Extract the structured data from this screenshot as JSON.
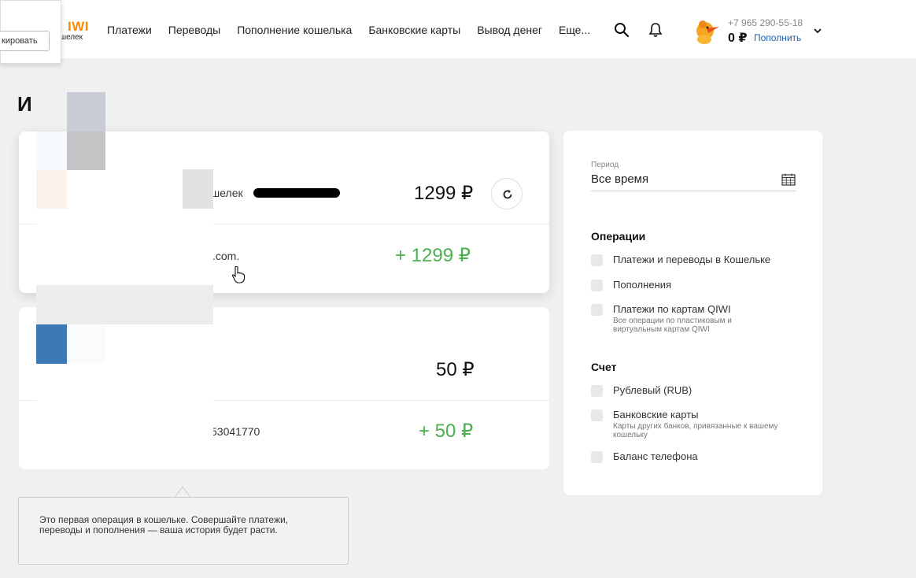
{
  "header": {
    "logo_brand": "IWI",
    "logo_sub": "шелек",
    "nav": [
      "Платежи",
      "Переводы",
      "Пополнение кошелька",
      "Банковские карты",
      "Вывод денег",
      "Еще..."
    ],
    "phone": "+7 965 290-55-18",
    "balance": "0 ₽",
    "topup_label": "Пополнить"
  },
  "popup": {
    "button_label": "кировать"
  },
  "page": {
    "title": "И"
  },
  "transactions": [
    {
      "title": "шелек",
      "amount": "1299 ₽",
      "detail": ".com.",
      "detail_amount": "+ 1299 ₽"
    },
    {
      "title": "",
      "amount": "50 ₽",
      "detail": "53041770",
      "detail_amount": "+ 50 ₽"
    }
  ],
  "filters": {
    "period_label": "Период",
    "period_value": "Все время",
    "operations_title": "Операции",
    "operations": [
      {
        "label": "Платежи и переводы в Кошельке",
        "hint": ""
      },
      {
        "label": "Пополнения",
        "hint": ""
      },
      {
        "label": "Платежи по картам QIWI",
        "hint": "Все операции по пластиковым и виртуальным картам QIWI"
      }
    ],
    "account_title": "Счет",
    "accounts": [
      {
        "label": "Рублевый (RUB)",
        "hint": ""
      },
      {
        "label": "Банковские карты",
        "hint": "Карты других банков, привязанные к вашему кошельку"
      },
      {
        "label": "Баланс телефона",
        "hint": ""
      }
    ]
  },
  "tooltip": {
    "text": "Это первая операция в кошельке. Совершайте платежи, переводы и пополнения — ваша история будет расти."
  },
  "colors": {
    "accent": "#ff8c00",
    "link": "#1c5fa8",
    "income": "#4caf50"
  }
}
